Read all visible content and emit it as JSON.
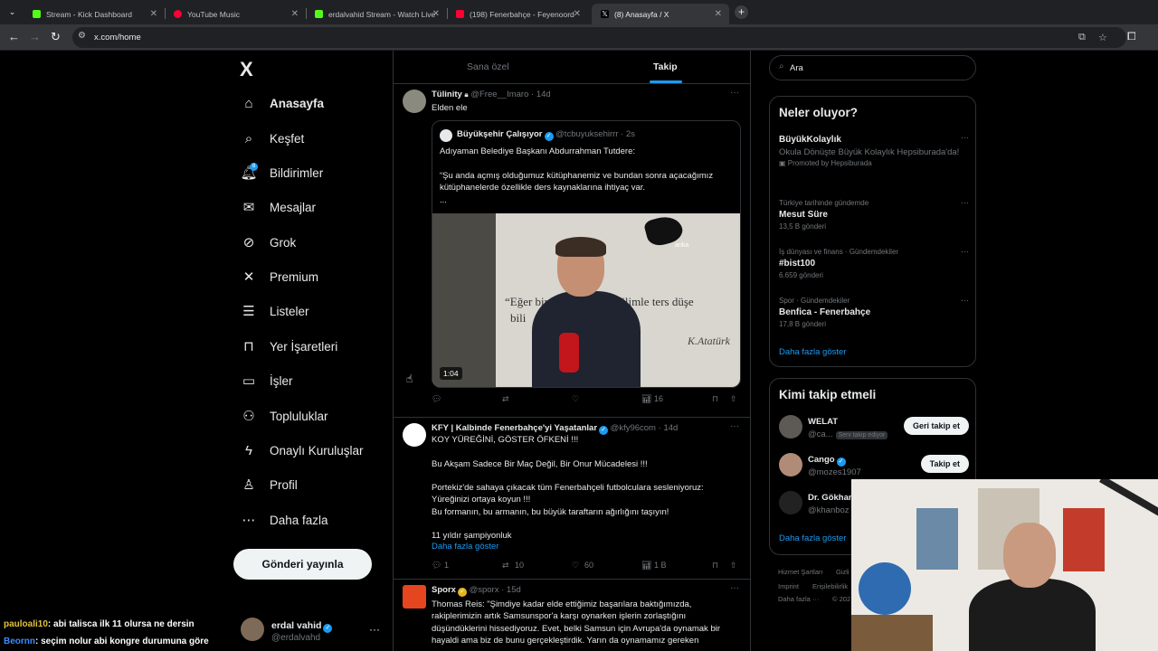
{
  "browser": {
    "tabs": [
      {
        "title": "Stream - Kick Dashboard",
        "fav_color": "#53fc18"
      },
      {
        "title": "YouTube Music",
        "fav_color": "#ff0033"
      },
      {
        "title": "erdalvahid Stream - Watch Live",
        "fav_color": "#53fc18"
      },
      {
        "title": "(198) Fenerbahçe - Feyenoord",
        "fav_color": "#ff0033"
      },
      {
        "title": "(8) Anasayfa / X",
        "fav_color": "#ffffff"
      }
    ],
    "url": "x.com/home"
  },
  "sidebar": {
    "logo": "X",
    "notif_count": "8",
    "items": [
      {
        "label": "Anasayfa",
        "icon": "⌂"
      },
      {
        "label": "Keşfet",
        "icon": "⌕"
      },
      {
        "label": "Bildirimler",
        "icon": "🔔︎"
      },
      {
        "label": "Mesajlar",
        "icon": "✉"
      },
      {
        "label": "Grok",
        "icon": "⊘"
      },
      {
        "label": "Premium",
        "icon": "✕"
      },
      {
        "label": "Listeler",
        "icon": "☰"
      },
      {
        "label": "Yer İşaretleri",
        "icon": "⊓"
      },
      {
        "label": "İşler",
        "icon": "▭"
      },
      {
        "label": "Topluluklar",
        "icon": "⚇"
      },
      {
        "label": "Onaylı Kuruluşlar",
        "icon": "ϟ"
      },
      {
        "label": "Profil",
        "icon": "♙"
      },
      {
        "label": "Daha fazla",
        "icon": "⋯"
      }
    ],
    "post_button": "Gönderi yayınla",
    "profile": {
      "name": "erdal vahid",
      "handle": "@erdalvahd"
    }
  },
  "feed": {
    "tabs": [
      "Sana özel",
      "Takip"
    ],
    "tweets": [
      {
        "name": "Tülinity",
        "handle": "@Free__Imaro",
        "time": "14d",
        "text": "Elden ele",
        "quote": {
          "name": "Büyükşehir Çalışıyor",
          "handle": "@tcbuyuksehirrr",
          "time": "2s",
          "line1": "Adıyaman Belediye Başkanı Abdurrahman Tutdere:",
          "line2": "“Şu anda açmış olduğumuz kütüphanemiz ve bundan sonra açacağımız kütüphanelerde özellikle ders kaynaklarına ihtiyaç var.",
          "line3": "...",
          "video": {
            "duration": "1:04",
            "wall_text": "“Eğer bir    nim sözlerim bilimle ters düşe",
            "wall_text2": "bili",
            "brand": "anka",
            "signature": "K.Atatürk"
          }
        },
        "views": "16"
      },
      {
        "name": "KFY | Kalbinde Fenerbahçe'yi Yaşatanlar",
        "handle": "@kfy96com",
        "time": "14d",
        "lines": [
          "KOY YÜREĞİNİ, GÖSTER ÖFKENİ !!!",
          "",
          "Bu Akşam Sadece Bir Maç Değil, Bir Onur Mücadelesi !!!",
          "",
          "Portekiz'de sahaya çıkacak tüm Fenerbahçeli futbolculara sesleniyoruz:",
          "Yüreğinizi ortaya koyun !!!",
          "Bu formanın, bu armanın, bu büyük taraftarın ağırlığını taşıyın!",
          "",
          "11 yıldır şampiyonluk"
        ],
        "show_more": "Daha fazla göster",
        "replies": "1",
        "retweets": "10",
        "likes": "60",
        "views": "1 B"
      },
      {
        "name": "Sporx",
        "handle": "@sporx",
        "time": "15d",
        "lines": [
          "Thomas Reis: \"Şimdiye kadar elde ettiğimiz başarılara baktığımızda,",
          "rakiplerimizin artık Samsunspor'a karşı oynarken işlerin zorlaştığını",
          "düşündüklerini hissediyoruz. Evet, belki Samsun için Avrupa'da oynamak bir",
          "hayaldi ama biz de bunu gerçekleştirdik. Yarın da oynamamız gereken"
        ]
      }
    ]
  },
  "right": {
    "search_placeholder": "Ara",
    "trends_title": "Neler oluyor?",
    "trends": [
      {
        "sub": "",
        "main": "BüyükKolaylık",
        "desc": "Okula Dönüşte Büyük Kolaylık Hepsiburada'da!",
        "promo": "Promoted by Hepsiburada"
      },
      {
        "sub": "Türkiye tarihinde gündemde",
        "main": "Mesut Süre",
        "count": "13,5 B gönderi"
      },
      {
        "sub": "İş dünyası ve finans · Gündemdekiler",
        "main": "#bist100",
        "count": "6.659 gönderi"
      },
      {
        "sub": "Spor · Gündemdekiler",
        "main": "Benfica - Fenerbahçe",
        "count": "17,8 B gönderi"
      }
    ],
    "trends_more": "Daha fazla göster",
    "who_title": "Kimi takip etmeli",
    "who": [
      {
        "name": "WELAT",
        "handle": "@ca...",
        "badge": "Seni takip ediyor",
        "button": "Geri takip et"
      },
      {
        "name": "Cango",
        "handle": "@mozes1907",
        "button": "Takip et"
      },
      {
        "name": "Dr. Gökhan",
        "handle": "@khanboz"
      }
    ],
    "who_more": "Daha fazla göster",
    "footer": [
      "Hizmet Şartları",
      "Gizli",
      "Imprint",
      "Erişilebilirlik",
      "Daha fazla ···",
      "© 202"
    ]
  },
  "chat": [
    {
      "user": "pauloali10",
      "msg": ": abi talisca ilk 11 olursa ne dersin"
    },
    {
      "user": "Beornn",
      "msg": ": seçim nolur abi kongre durumuna göre"
    }
  ]
}
